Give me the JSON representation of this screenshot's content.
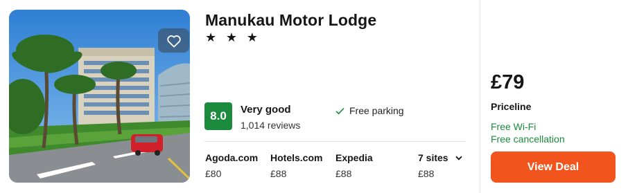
{
  "hotel": {
    "name": "Manukau Motor Lodge",
    "stars": "★ ★ ★",
    "score": "8.0",
    "rating_label": "Very good",
    "reviews": "1,014 reviews",
    "amenity": "Free parking"
  },
  "providers": [
    {
      "name": "Agoda.com",
      "price": "£80"
    },
    {
      "name": "Hotels.com",
      "price": "£88"
    },
    {
      "name": "Expedia",
      "price": "£88"
    }
  ],
  "sites": {
    "label": "7 sites",
    "price": "£88"
  },
  "deal": {
    "price": "£79",
    "provider": "Priceline",
    "perk1": "Free Wi-Fi",
    "perk2": "Free cancellation",
    "button": "View Deal"
  },
  "icons": {
    "favorite": "heart-icon",
    "check": "check-icon",
    "dropdown": "chevron-down-icon"
  },
  "colors": {
    "score_bg": "#1b8a3c",
    "deal_button": "#f1541c",
    "perk_text": "#1b8a3c"
  }
}
